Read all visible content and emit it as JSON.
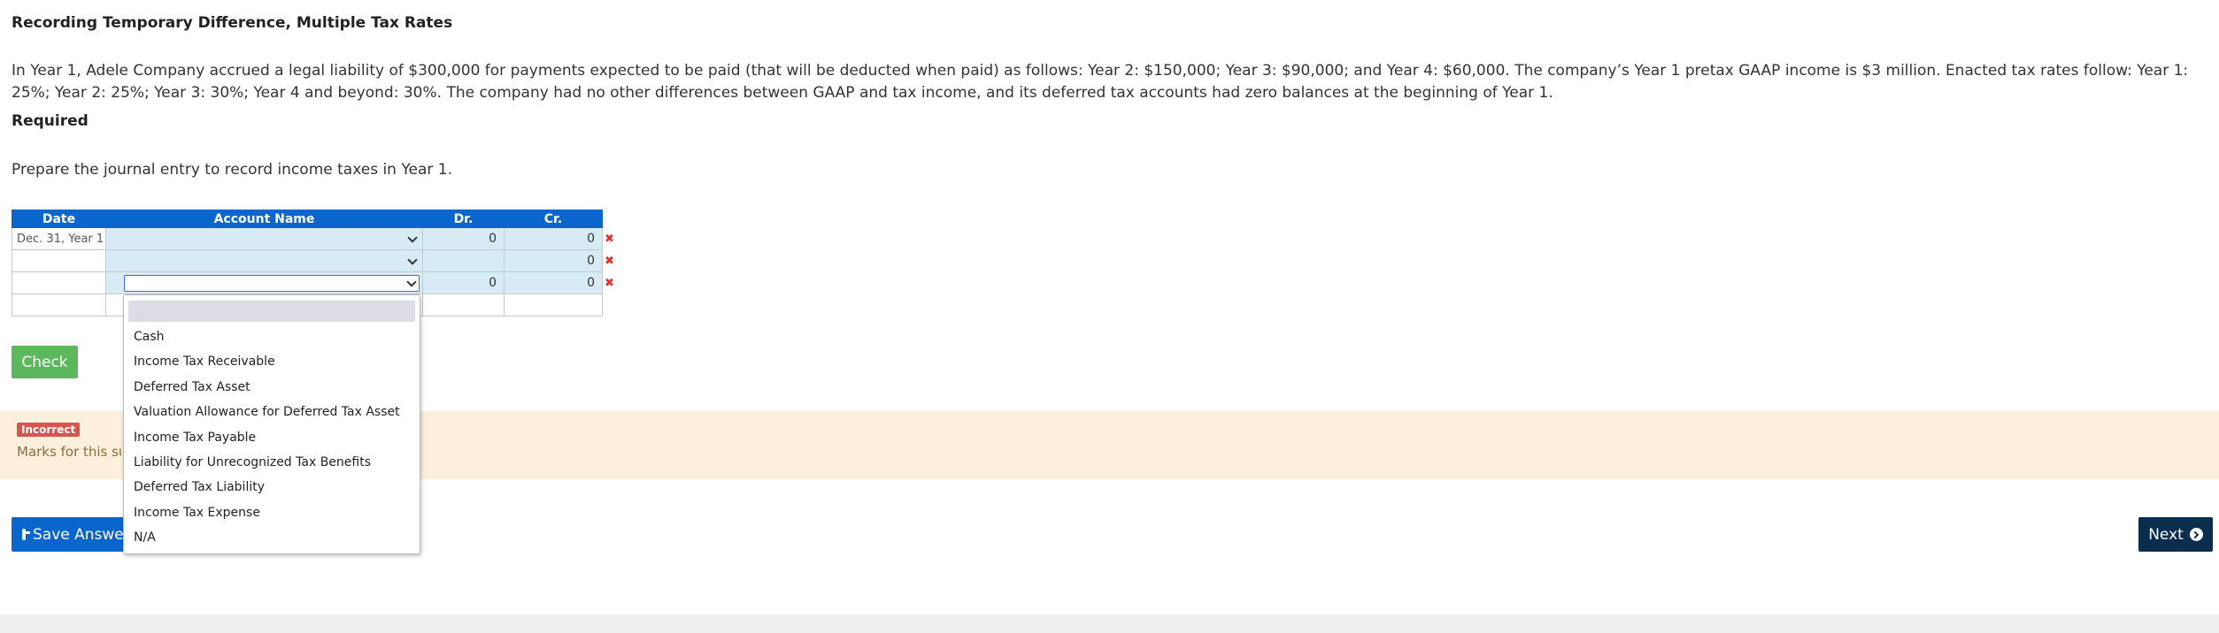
{
  "title": "Recording Temporary Difference, Multiple Tax Rates",
  "problem_text": "In Year 1, Adele Company accrued a legal liability of $300,000 for payments expected to be paid (that will be deducted when paid) as follows: Year 2: $150,000; Year 3: $90,000; and Year 4: $60,000. The company’s Year 1 pretax GAAP income is $3 million. Enacted tax rates follow: Year 1: 25%; Year 2: 25%; Year 3: 30%; Year 4 and beyond: 30%. The company had no other differences between GAAP and tax income, and its deferred tax accounts had zero balances at the beginning of Year 1.",
  "required_label": "Required",
  "instruction": "Prepare the journal entry to record income taxes in Year 1.",
  "table": {
    "headers": {
      "date": "Date",
      "account": "Account Name",
      "dr": "Dr.",
      "cr": "Cr."
    },
    "rows": [
      {
        "date": "Dec. 31, Year 1",
        "dr": "0",
        "cr": "0"
      },
      {
        "date": "",
        "dr": "",
        "cr": "0"
      },
      {
        "date": "",
        "dr": "0",
        "cr": "0"
      },
      {
        "date": "",
        "dr": "",
        "cr": ""
      }
    ],
    "delete_symbol": "✖"
  },
  "dropdown": {
    "options": [
      "Cash",
      "Income Tax Receivable",
      "Deferred Tax Asset",
      "Valuation Allowance for Deferred Tax Asset",
      "Income Tax Payable",
      "Liability for Unrecognized Tax Benefits",
      "Deferred Tax Liability",
      "Income Tax Expense",
      "N/A"
    ]
  },
  "check_label": "Check",
  "feedback": {
    "badge": "Incorrect",
    "marks_text": "Marks for this submission"
  },
  "save_label": "Save Answers",
  "next_label": "Next",
  "colors": {
    "header_blue": "#0a66cc",
    "cell_blue": "#d6ebf3",
    "check_green": "#5cb85c",
    "incorrect_red": "#d9534f",
    "feedback_bg": "#fcefdc",
    "next_navy": "#0b2e4f"
  }
}
